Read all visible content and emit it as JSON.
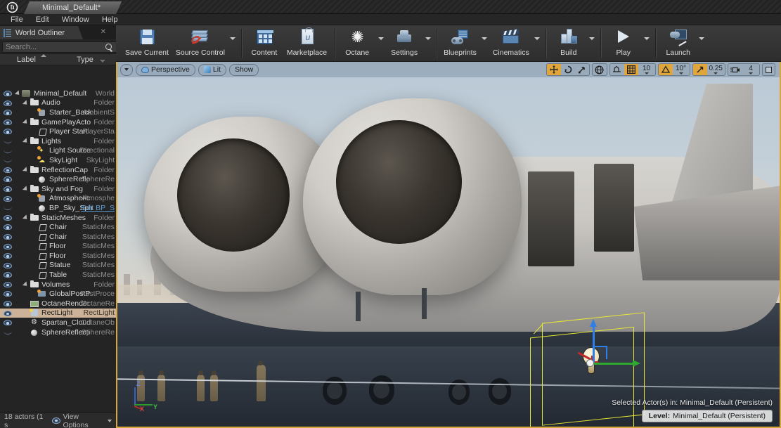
{
  "window": {
    "logo_icon": "unreal-engine-logo",
    "tab_title": "Minimal_Default*"
  },
  "menubar": {
    "items": [
      "File",
      "Edit",
      "Window",
      "Help"
    ]
  },
  "outliner": {
    "tab_label": "World Outliner",
    "tab_icon": "outliner-list-icon",
    "close_icon": "close-icon",
    "search": {
      "placeholder": "Search...",
      "value": ""
    },
    "search_icon": "search-icon",
    "add_icon": "add-item-icon",
    "columns": {
      "label": "Label",
      "type": "Type"
    },
    "sort": "Label ascending",
    "status": {
      "actors": "18 actors (1 s",
      "view_options": "View Options"
    },
    "rows": [
      {
        "label": "Minimal_Default",
        "type": "World",
        "indent": 0,
        "icon": "world-icon",
        "visible": true,
        "expander": true,
        "selected": false
      },
      {
        "label": "Audio",
        "type": "Folder",
        "indent": 1,
        "icon": "folder-icon",
        "visible": true,
        "expander": true,
        "selected": false
      },
      {
        "label": "Starter_Back",
        "type": "AmbientS",
        "indent": 2,
        "icon": "audio-icon",
        "visible": true,
        "expander": false,
        "selected": false
      },
      {
        "label": "GamePlayActo",
        "type": "Folder",
        "indent": 1,
        "icon": "folder-icon",
        "visible": true,
        "expander": true,
        "selected": false
      },
      {
        "label": "Player Start",
        "type": "PlayerSta",
        "indent": 2,
        "icon": "player-start-icon",
        "visible": true,
        "expander": false,
        "selected": false
      },
      {
        "label": "Lights",
        "type": "Folder",
        "indent": 1,
        "icon": "folder-icon",
        "visible": false,
        "expander": true,
        "selected": false
      },
      {
        "label": "Light Source",
        "type": "Directional",
        "indent": 2,
        "icon": "light-icon",
        "visible": false,
        "expander": false,
        "selected": false
      },
      {
        "label": "SkyLight",
        "type": "SkyLight",
        "indent": 2,
        "icon": "skylight-icon",
        "visible": false,
        "expander": false,
        "selected": false
      },
      {
        "label": "ReflectionCap",
        "type": "Folder",
        "indent": 1,
        "icon": "folder-icon",
        "visible": true,
        "expander": true,
        "selected": false
      },
      {
        "label": "SphereRefle",
        "type": "SphereRe",
        "indent": 2,
        "icon": "sphere-reflection-icon",
        "visible": true,
        "expander": false,
        "selected": false
      },
      {
        "label": "Sky and Fog",
        "type": "Folder",
        "indent": 1,
        "icon": "folder-icon",
        "visible": true,
        "expander": true,
        "selected": false
      },
      {
        "label": "Atmospheric",
        "type": "Atmosphe",
        "indent": 2,
        "icon": "atmospheric-fog-icon",
        "visible": true,
        "expander": false,
        "selected": false
      },
      {
        "label": "BP_Sky_Sph",
        "type": "",
        "link": "Edit BP_S",
        "indent": 2,
        "icon": "sphere-icon",
        "visible": false,
        "expander": false,
        "selected": false
      },
      {
        "label": "StaticMeshes",
        "type": "Folder",
        "indent": 1,
        "icon": "folder-icon",
        "visible": true,
        "expander": true,
        "selected": false
      },
      {
        "label": "Chair",
        "type": "StaticMes",
        "indent": 2,
        "icon": "static-mesh-icon",
        "visible": true,
        "expander": false,
        "selected": false
      },
      {
        "label": "Chair",
        "type": "StaticMes",
        "indent": 2,
        "icon": "static-mesh-icon",
        "visible": true,
        "expander": false,
        "selected": false
      },
      {
        "label": "Floor",
        "type": "StaticMes",
        "indent": 2,
        "icon": "static-mesh-icon",
        "visible": true,
        "expander": false,
        "selected": false
      },
      {
        "label": "Floor",
        "type": "StaticMes",
        "indent": 2,
        "icon": "static-mesh-icon",
        "visible": true,
        "expander": false,
        "selected": false
      },
      {
        "label": "Statue",
        "type": "StaticMes",
        "indent": 2,
        "icon": "static-mesh-icon",
        "visible": true,
        "expander": false,
        "selected": false
      },
      {
        "label": "Table",
        "type": "StaticMes",
        "indent": 2,
        "icon": "static-mesh-icon",
        "visible": true,
        "expander": false,
        "selected": false
      },
      {
        "label": "Volumes",
        "type": "Folder",
        "indent": 1,
        "icon": "folder-icon",
        "visible": true,
        "expander": true,
        "selected": false
      },
      {
        "label": "GlobalPostP",
        "type": "PostProce",
        "indent": 2,
        "icon": "post-process-icon",
        "visible": true,
        "expander": false,
        "selected": false
      },
      {
        "label": "OctaneRender",
        "type": "OctaneRe",
        "indent": 1,
        "icon": "octane-render-icon",
        "visible": true,
        "expander": false,
        "selected": false
      },
      {
        "label": "RectLight",
        "type": "RectLight",
        "indent": 1,
        "icon": "rect-light-icon",
        "visible": true,
        "expander": false,
        "selected": true
      },
      {
        "label": "Spartan_Cloud",
        "type": "OctaneOb",
        "indent": 1,
        "icon": "octane-object-icon",
        "visible": true,
        "expander": false,
        "selected": false
      },
      {
        "label": "SphereReflecti",
        "type": "SphereRe",
        "indent": 1,
        "icon": "sphere-reflection-icon",
        "visible": false,
        "expander": false,
        "selected": false
      }
    ]
  },
  "toolbar": {
    "buttons": [
      {
        "label": "Save Current",
        "icon": "save-icon",
        "dropdown": false
      },
      {
        "label": "Source Control",
        "icon": "source-control-icon",
        "dropdown": true
      },
      {
        "label": "Content",
        "icon": "content-browser-icon",
        "dropdown": false
      },
      {
        "label": "Marketplace",
        "icon": "marketplace-icon",
        "dropdown": false
      },
      {
        "label": "Octane",
        "icon": "octane-icon",
        "dropdown": true
      },
      {
        "label": "Settings",
        "icon": "settings-icon",
        "dropdown": true
      },
      {
        "label": "Blueprints",
        "icon": "blueprints-icon",
        "dropdown": true
      },
      {
        "label": "Cinematics",
        "icon": "cinematics-icon",
        "dropdown": true
      },
      {
        "label": "Build",
        "icon": "build-icon",
        "dropdown": true
      },
      {
        "label": "Play",
        "icon": "play-icon",
        "dropdown": true
      },
      {
        "label": "Launch",
        "icon": "launch-icon",
        "dropdown": true
      }
    ]
  },
  "viewport": {
    "options_icon": "viewport-options-icon",
    "view_mode": "Perspective",
    "view_mode_icon": "perspective-camera-icon",
    "lighting_mode": "Lit",
    "lighting_icon": "lit-cube-icon",
    "show_menu": "Show",
    "transform_icons": [
      "translate-mode-icon",
      "rotate-mode-icon",
      "scale-mode-icon"
    ],
    "world_coords_icon": "world-coordinates-icon",
    "surface_snap_icon": "surface-snap-icon",
    "grid_snap_icon": "grid-snap-icon",
    "grid_snap_value": "10",
    "angle_snap_icon": "angle-snap-icon",
    "angle_snap_value": "10°",
    "scale_snap_icon": "scale-snap-icon",
    "scale_snap_value": "0.25",
    "camera_speed_icon": "camera-speed-icon",
    "camera_speed_value": "4",
    "maximize_icon": "maximize-viewport-icon",
    "axis_labels": {
      "x": "X",
      "y": "Y",
      "z": "Z"
    },
    "selected_actors_text": "Selected Actor(s) in:  Minimal_Default (Persistent)",
    "level_label": "Level:",
    "level_name": "Minimal_Default (Persistent)",
    "gizmo": "translate-gizmo",
    "selected_actor_icon": "light-bulb-billboard-icon"
  },
  "colors": {
    "selection": "#cbb298",
    "viewport_border": "#d6a73a",
    "snap_active": "#e0a63c",
    "axis_x": "#c02a2a",
    "axis_y": "#2faa2f",
    "axis_z": "#2f7fe8",
    "selection_box": "#e8e832",
    "link": "#5b9bd5"
  }
}
